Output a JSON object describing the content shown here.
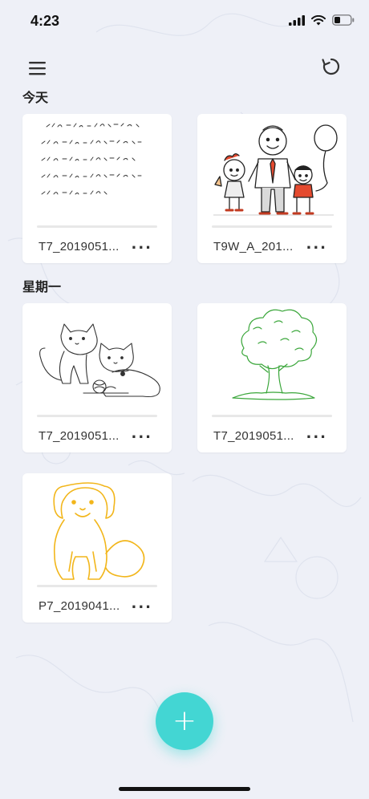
{
  "status": {
    "time": "4:23"
  },
  "toolbar": {
    "menu_icon": "menu-icon",
    "refresh_icon": "refresh-icon"
  },
  "sections": [
    {
      "title": "今天",
      "items": [
        {
          "name": "T7_2019051...",
          "thumbnail": "handwriting-text"
        },
        {
          "name": "T9W_A_201...",
          "thumbnail": "family-drawing"
        }
      ]
    },
    {
      "title": "星期一",
      "items": [
        {
          "name": "T7_2019051...",
          "thumbnail": "cats-drawing"
        },
        {
          "name": "T7_2019051...",
          "thumbnail": "tree-drawing"
        },
        {
          "name": "P7_2019041...",
          "thumbnail": "dog-drawing"
        }
      ]
    }
  ],
  "more_label": "...",
  "fab": {
    "label": "+",
    "icon": "plus-icon"
  },
  "colors": {
    "accent": "#43d6d3",
    "background": "#eef0f7",
    "tree": "#3aa63a",
    "dog": "#f2b61b"
  }
}
